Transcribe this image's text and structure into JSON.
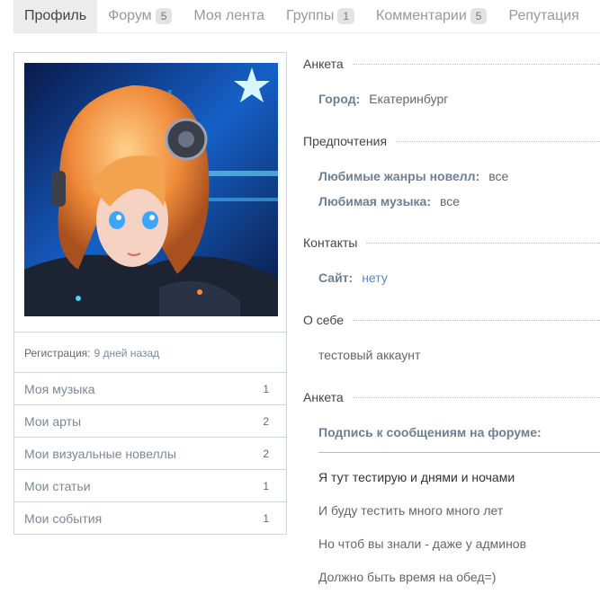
{
  "tabs": [
    {
      "label": "Профиль",
      "count": null
    },
    {
      "label": "Форум",
      "count": "5"
    },
    {
      "label": "Моя лента",
      "count": null
    },
    {
      "label": "Группы",
      "count": "1"
    },
    {
      "label": "Комментарии",
      "count": "5"
    },
    {
      "label": "Репутация",
      "count": null
    }
  ],
  "profile": {
    "registration_label": "Регистрация:",
    "registration_value": "9 дней назад",
    "menu": [
      {
        "label": "Моя музыка",
        "count": "1"
      },
      {
        "label": "Мои арты",
        "count": "2"
      },
      {
        "label": "Мои визуальные новеллы",
        "count": "2"
      },
      {
        "label": "Мои статьи",
        "count": "1"
      },
      {
        "label": "Мои события",
        "count": "1"
      }
    ]
  },
  "info": {
    "anketa_title": "Анкета",
    "city_label": "Город:",
    "city_value": "Екатеринбург",
    "prefs_title": "Предпочтения",
    "genres_label": "Любимые жанры новелл:",
    "genres_value": "все",
    "music_label": "Любимая музыка:",
    "music_value": "все",
    "contacts_title": "Контакты",
    "site_label": "Сайт:",
    "site_value": "нету",
    "about_title": "О себе",
    "about_value": "тестовый аккаунт",
    "anketa2_title": "Анкета",
    "signature_label": "Подпись к сообщениям на форуме:",
    "signature_lines": [
      "Я тут тестирую и днями и ночами",
      "И буду тестить много много лет",
      "Но чтоб вы знали - даже у админов",
      "Должно быть время на обед=)"
    ]
  }
}
